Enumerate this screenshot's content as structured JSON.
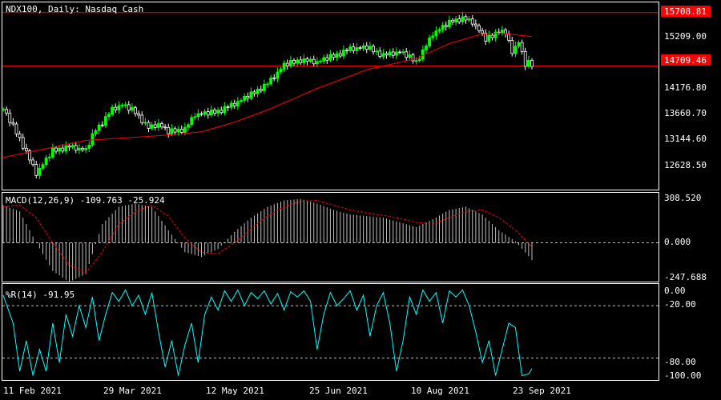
{
  "colors": {
    "background": "#000000",
    "frame": "#ffffff",
    "bull_candle": "#00ff00",
    "bear_candle": "#ffffff",
    "moving_average": "#ff0000",
    "level_lines": "#ff0000",
    "level_label_bg": "#ff0000",
    "macd_histogram": "#c0c0c0",
    "macd_signal": "#ff0000",
    "williams_r": "#00ffff",
    "dotted_levels": "#c0c0c0"
  },
  "chart_data": [
    {
      "type": "candlestick",
      "title": "NDX100, Daily:  Nasdaq Cash",
      "ylim": [
        12400,
        15900
      ],
      "y_ticks": [
        "15209.00",
        "14176.80",
        "13660.70",
        "13144.60",
        "12628.50"
      ],
      "levels": [
        {
          "value": 15708.81,
          "label": "15708.81"
        },
        {
          "value": 14709.46,
          "label": "14709.46"
        }
      ],
      "moving_average": {
        "x": [
          0,
          25,
          40,
          50,
          60,
          70,
          80,
          95,
          110,
          125,
          135,
          145,
          150,
          160
        ],
        "y": [
          13000,
          13320,
          13380,
          13420,
          13480,
          13660,
          13890,
          14290,
          14640,
          14850,
          15130,
          15310,
          15330,
          15260
        ]
      },
      "price_series": {
        "x": [
          0,
          5,
          10,
          15,
          20,
          25,
          28,
          30,
          33,
          36,
          40,
          44,
          47,
          50,
          55,
          58,
          62,
          65,
          70,
          75,
          80,
          85,
          90,
          95,
          100,
          105,
          110,
          115,
          120,
          125,
          127,
          130,
          133,
          136,
          139,
          142,
          144,
          146,
          148,
          150,
          152,
          154,
          156,
          158,
          159,
          160
        ],
        "y": [
          13900,
          13350,
          12700,
          13120,
          13200,
          13130,
          13520,
          13650,
          13900,
          13980,
          13840,
          13550,
          13620,
          13470,
          13530,
          13800,
          13820,
          13860,
          14000,
          14170,
          14380,
          14720,
          14820,
          14780,
          14890,
          15030,
          15050,
          14910,
          14970,
          14790,
          14980,
          15310,
          15430,
          15550,
          15600,
          15530,
          15370,
          15200,
          15260,
          15380,
          15320,
          14980,
          15150,
          14730,
          14760,
          14720
        ]
      }
    },
    {
      "type": "bar",
      "title": "MACD(12,26,9) -109.763 -25.924",
      "ylim": [
        -247.688,
        308.52
      ],
      "y_ticks": [
        "308.520",
        "0.000",
        "-247.688"
      ],
      "macd": {
        "x": [
          0,
          5,
          10,
          15,
          20,
          25,
          30,
          35,
          40,
          45,
          50,
          55,
          60,
          65,
          70,
          75,
          80,
          85,
          90,
          95,
          100,
          105,
          110,
          115,
          120,
          125,
          130,
          135,
          140,
          145,
          150,
          155,
          160
        ],
        "y": [
          240,
          200,
          0,
          -180,
          -250,
          -200,
          120,
          230,
          250,
          230,
          80,
          -60,
          -90,
          -40,
          70,
          160,
          230,
          270,
          280,
          250,
          210,
          180,
          170,
          160,
          130,
          100,
          150,
          210,
          230,
          180,
          80,
          10,
          -110
        ]
      },
      "signal": {
        "x": [
          0,
          5,
          10,
          15,
          20,
          25,
          30,
          35,
          40,
          45,
          50,
          55,
          60,
          65,
          70,
          75,
          80,
          85,
          90,
          95,
          100,
          105,
          110,
          115,
          120,
          125,
          130,
          135,
          140,
          145,
          150,
          155,
          160
        ],
        "y": [
          230,
          240,
          160,
          0,
          -140,
          -190,
          -60,
          120,
          200,
          240,
          170,
          30,
          -60,
          -70,
          0,
          90,
          170,
          230,
          265,
          270,
          240,
          210,
          190,
          175,
          155,
          130,
          120,
          160,
          200,
          210,
          160,
          80,
          -26
        ]
      }
    },
    {
      "type": "line",
      "title": "%R(14) -91.95",
      "ylim": [
        -105,
        3
      ],
      "y_ticks": [
        "0.00",
        "-20.00",
        "-80.00",
        "-100.00"
      ],
      "levels": [
        -20,
        -80
      ],
      "series": {
        "x": [
          0,
          3,
          5,
          7,
          9,
          11,
          13,
          15,
          17,
          19,
          21,
          23,
          25,
          27,
          29,
          31,
          33,
          35,
          37,
          39,
          41,
          43,
          45,
          47,
          49,
          51,
          53,
          55,
          57,
          59,
          61,
          63,
          65,
          67,
          69,
          71,
          73,
          75,
          77,
          79,
          81,
          83,
          85,
          87,
          89,
          91,
          93,
          95,
          97,
          99,
          101,
          103,
          105,
          107,
          109,
          111,
          113,
          115,
          117,
          119,
          121,
          123,
          125,
          127,
          129,
          131,
          133,
          135,
          137,
          139,
          141,
          143,
          145,
          147,
          149,
          151,
          153,
          155,
          157,
          159,
          160
        ],
        "y": [
          -8,
          -40,
          -95,
          -60,
          -100,
          -70,
          -95,
          -40,
          -85,
          -30,
          -55,
          -20,
          -45,
          -10,
          -60,
          -30,
          -5,
          -15,
          -2,
          -20,
          -8,
          -30,
          -5,
          -50,
          -90,
          -60,
          -100,
          -65,
          -40,
          -85,
          -30,
          -10,
          -25,
          -3,
          -15,
          -2,
          -20,
          -5,
          -12,
          -3,
          -18,
          -6,
          -25,
          -4,
          -10,
          -3,
          -15,
          -70,
          -30,
          -5,
          -20,
          -12,
          -3,
          -25,
          -8,
          -55,
          -20,
          -5,
          -40,
          -95,
          -60,
          -10,
          -30,
          -2,
          -15,
          -5,
          -40,
          -3,
          -10,
          -2,
          -20,
          -50,
          -85,
          -60,
          -100,
          -70,
          -40,
          -45,
          -100,
          -98,
          -92
        ]
      }
    }
  ],
  "x_axis_labels": [
    "11 Feb 2021",
    "29 Mar 2021",
    "12 May 2021",
    "25 Jun 2021",
    "10 Aug 2021",
    "23 Sep 2021"
  ]
}
